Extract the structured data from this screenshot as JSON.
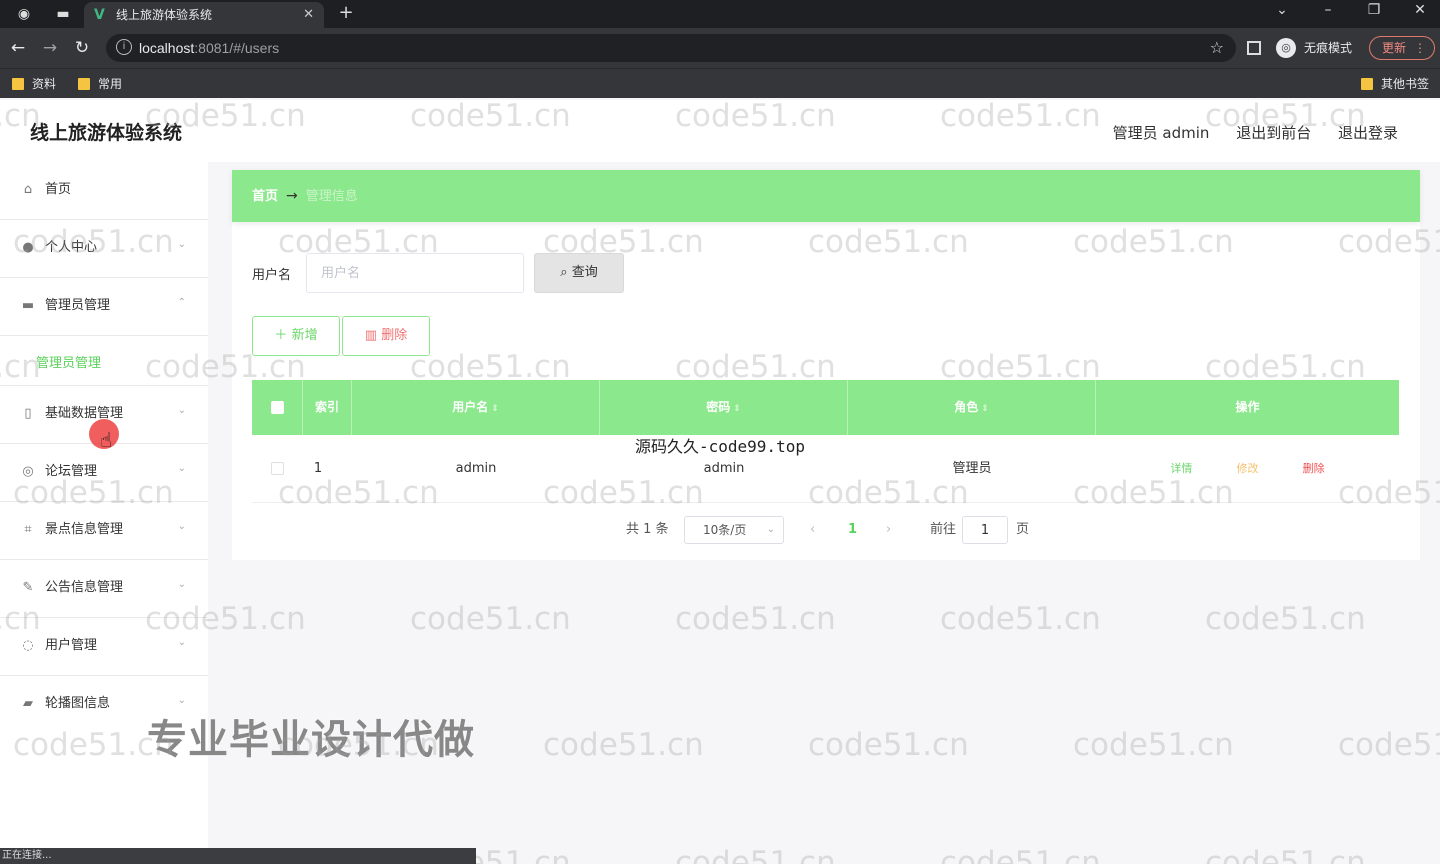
{
  "browser": {
    "tab_title": "线上旅游体验系统",
    "tab_close": "✕",
    "new_tab": "+",
    "url_host": "localhost",
    "url_rest": ":8081/#/users",
    "incognito_label": "无痕模式",
    "update_label": "更新",
    "bookmarks": [
      "资料",
      "常用"
    ],
    "other_bookmarks": "其他书签",
    "status_text": "正在连接..."
  },
  "header": {
    "title": "线上旅游体验系统",
    "user_label": "管理员 admin",
    "to_front": "退出到前台",
    "logout": "退出登录"
  },
  "sidebar": {
    "items": [
      {
        "label": "首页",
        "icon": "home-icon"
      },
      {
        "label": "个人中心",
        "icon": "user-icon"
      },
      {
        "label": "管理员管理",
        "icon": "briefcase-icon"
      },
      {
        "label": "基础数据管理",
        "icon": "mic-icon"
      },
      {
        "label": "论坛管理",
        "icon": "compass-icon"
      },
      {
        "label": "景点信息管理",
        "icon": "crop-icon"
      },
      {
        "label": "公告信息管理",
        "icon": "edit-icon"
      },
      {
        "label": "用户管理",
        "icon": "mic-icon"
      },
      {
        "label": "轮播图信息",
        "icon": "ticket-icon"
      }
    ],
    "active_subitem": "管理员管理"
  },
  "breadcrumb": {
    "home": "首页",
    "separator": "→",
    "current": "管理信息"
  },
  "search": {
    "label": "用户名",
    "placeholder": "用户名",
    "button": "查询"
  },
  "actions": {
    "add": "新增",
    "delete": "删除"
  },
  "table": {
    "columns": [
      "索引",
      "用户名",
      "密码",
      "角色",
      "操作"
    ],
    "rows": [
      {
        "index": "1",
        "username": "admin",
        "password": "admin",
        "role": "管理员"
      }
    ],
    "ops": {
      "detail": "详情",
      "edit": "修改",
      "delete": "删除"
    }
  },
  "pagination": {
    "total": "共 1 条",
    "page_size": "10条/页",
    "current_page": "1",
    "goto_label": "前往",
    "goto_value": "1",
    "page_suffix": "页"
  },
  "overlay": {
    "source_text": "源码久久-code99.top",
    "promo_text": "专业毕业设计代做",
    "watermark": "code51.cn"
  },
  "colors": {
    "accent": "#8ce88c",
    "accent_text": "#5bd25b",
    "danger": "#f05050",
    "warning": "#f5c070"
  }
}
